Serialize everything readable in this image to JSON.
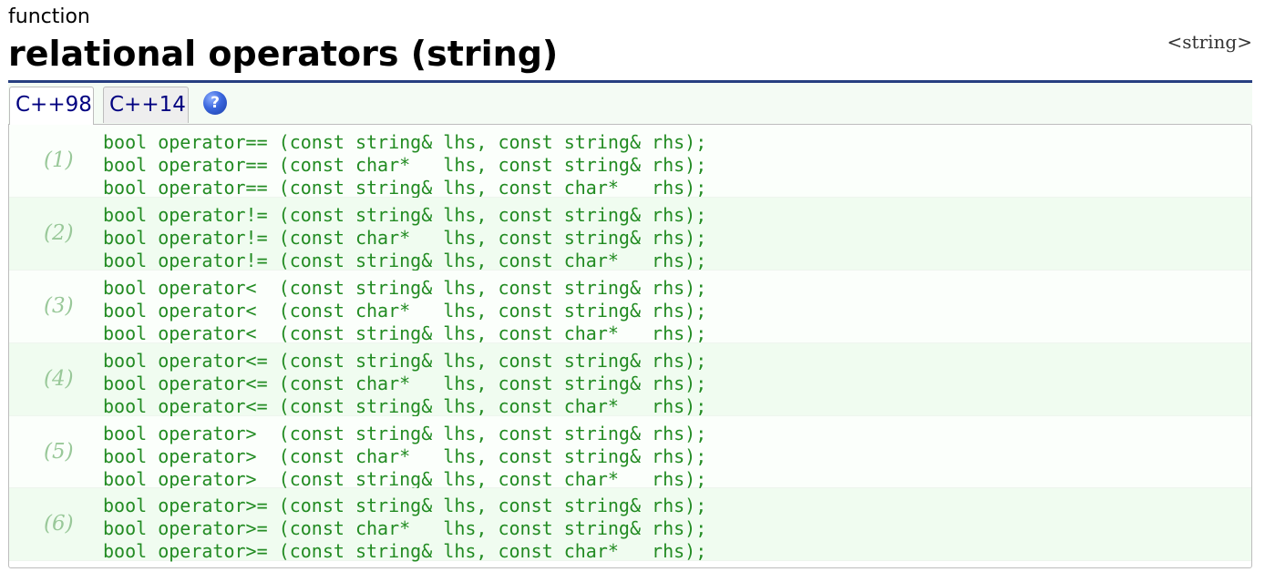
{
  "header": {
    "kind": "function",
    "title": "relational operators (string)",
    "header_link": "<string>"
  },
  "tabs": [
    {
      "label": "C++98",
      "active": true
    },
    {
      "label": "C++14",
      "active": false
    }
  ],
  "help_icon": "help-icon",
  "colors": {
    "rule": "#273f80",
    "code": "#228b22",
    "group_number": "#99c899",
    "tab_text": "#000080",
    "help": "#3a66dd"
  },
  "groups": [
    {
      "num": "(1)",
      "lines": [
        "bool operator== (const string& lhs, const string& rhs);",
        "bool operator== (const char*   lhs, const string& rhs);",
        "bool operator== (const string& lhs, const char*   rhs);"
      ]
    },
    {
      "num": "(2)",
      "lines": [
        "bool operator!= (const string& lhs, const string& rhs);",
        "bool operator!= (const char*   lhs, const string& rhs);",
        "bool operator!= (const string& lhs, const char*   rhs);"
      ]
    },
    {
      "num": "(3)",
      "lines": [
        "bool operator<  (const string& lhs, const string& rhs);",
        "bool operator<  (const char*   lhs, const string& rhs);",
        "bool operator<  (const string& lhs, const char*   rhs);"
      ]
    },
    {
      "num": "(4)",
      "lines": [
        "bool operator<= (const string& lhs, const string& rhs);",
        "bool operator<= (const char*   lhs, const string& rhs);",
        "bool operator<= (const string& lhs, const char*   rhs);"
      ]
    },
    {
      "num": "(5)",
      "lines": [
        "bool operator>  (const string& lhs, const string& rhs);",
        "bool operator>  (const char*   lhs, const string& rhs);",
        "bool operator>  (const string& lhs, const char*   rhs);"
      ]
    },
    {
      "num": "(6)",
      "lines": [
        "bool operator>= (const string& lhs, const string& rhs);",
        "bool operator>= (const char*   lhs, const string& rhs);",
        "bool operator>= (const string& lhs, const char*   rhs);"
      ]
    }
  ]
}
